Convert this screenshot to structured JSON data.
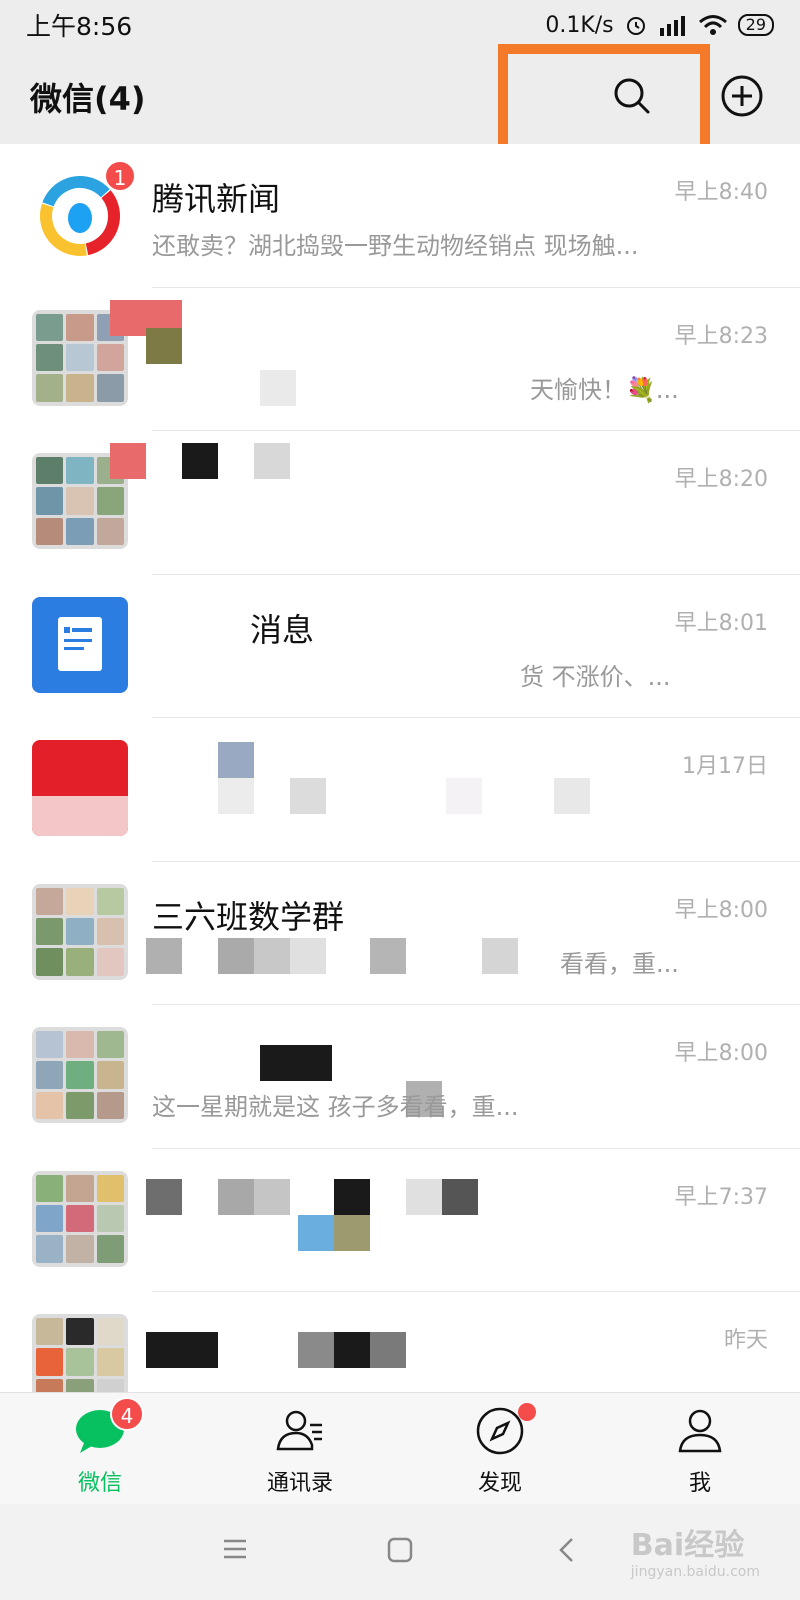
{
  "status_bar": {
    "time": "上午8:56",
    "speed": "0.1K/s",
    "battery": "29"
  },
  "header": {
    "title": "微信(4)"
  },
  "chats": [
    {
      "name": "腾讯新闻",
      "preview": "还敢卖？湖北捣毁一野生动物经销点 现场触...",
      "time": "早上8:40",
      "badge": "1"
    },
    {
      "name": "",
      "preview": "天愉快！💐...",
      "time": "早上8:23",
      "badge": ""
    },
    {
      "name": "",
      "preview": "",
      "time": "早上8:20",
      "badge": ""
    },
    {
      "name": "消息",
      "preview": "货 不涨价、...",
      "time": "早上8:01",
      "badge": ""
    },
    {
      "name": "",
      "preview": "",
      "time": "1月17日",
      "badge": ""
    },
    {
      "name": "三六班数学群",
      "preview": "看看，重...",
      "time": "早上8:00",
      "badge": ""
    },
    {
      "name": "",
      "preview": "这一星期就是这  孩子多看看，重...",
      "time": "早上8:00",
      "badge": ""
    },
    {
      "name": "",
      "preview": "",
      "time": "早上7:37",
      "badge": ""
    },
    {
      "name": "",
      "preview": "",
      "time": "昨天",
      "badge": ""
    }
  ],
  "tabs": [
    {
      "label": "微信",
      "badge": "4"
    },
    {
      "label": "通讯录"
    },
    {
      "label": "发现"
    },
    {
      "label": "我"
    }
  ],
  "watermark": {
    "brand": "Bai经验",
    "url": "jingyan.baidu.com"
  },
  "colors": {
    "accent": "#07c160",
    "highlight": "#f47a2a",
    "badge": "#f44b4b"
  }
}
